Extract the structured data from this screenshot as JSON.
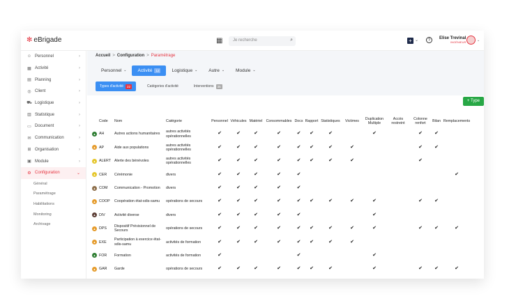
{
  "topbar": {
    "logo": "eBrigade",
    "search_placeholder": "Je recherche",
    "user_name": "Elise Trevinal",
    "user_role": "INGÉNIEUR"
  },
  "sidebar": {
    "items": [
      {
        "label": "Personnel",
        "icon": "person-icon",
        "glyph": "☺"
      },
      {
        "label": "Activité",
        "icon": "calendar-icon",
        "glyph": "▦"
      },
      {
        "label": "Planning",
        "icon": "planning-icon",
        "glyph": "▤"
      },
      {
        "label": "Client",
        "icon": "client-icon",
        "glyph": "◎"
      },
      {
        "label": "Logistique",
        "icon": "logistics-icon",
        "glyph": "⛟"
      },
      {
        "label": "Statistique",
        "icon": "chart-icon",
        "glyph": "▥"
      },
      {
        "label": "Document",
        "icon": "document-icon",
        "glyph": "▭"
      },
      {
        "label": "Communication",
        "icon": "mail-icon",
        "glyph": "✉"
      },
      {
        "label": "Organisation",
        "icon": "org-icon",
        "glyph": "⊞"
      },
      {
        "label": "Module",
        "icon": "module-icon",
        "glyph": "▣"
      },
      {
        "label": "Configuration",
        "icon": "gear-icon",
        "glyph": "⚙"
      }
    ],
    "sub_items": [
      "Général",
      "Paramétrage",
      "Habilitations",
      "Monitoring",
      "Archivage"
    ]
  },
  "breadcrumb": {
    "home": "Accueil",
    "section": "Configuration",
    "current": "Paramétrage",
    "sep": ">"
  },
  "tabs": [
    {
      "label": "Personnel",
      "chevron": "⌄"
    },
    {
      "label": "Activité",
      "count": "12",
      "active": true
    },
    {
      "label": "Logistique",
      "chevron": "⌄"
    },
    {
      "label": "Autre",
      "chevron": "⌄"
    },
    {
      "label": "Module",
      "chevron": "⌄"
    }
  ],
  "subtabs": [
    {
      "label": "Types d'activité",
      "badge": "22",
      "active": true
    },
    {
      "label": "Catégories d'activité"
    },
    {
      "label": "Interventions",
      "badge": "35"
    }
  ],
  "add_button": "+ Type",
  "table": {
    "headers": [
      "",
      "Code",
      "Nom",
      "Catégorie",
      "Personnel",
      "Véhicules",
      "Matériel",
      "Consommables",
      "Docs",
      "Rapport",
      "Statistiques",
      "Victimes",
      "Duplication Multiple",
      "Accès restreint",
      "Colonne renfort",
      "Bilan",
      "Remplacements"
    ],
    "check_glyph": "✔",
    "rows": [
      {
        "color": "#2e7d32",
        "code": "AH",
        "nom": "Autres actions humanitaires",
        "categorie": "autres activités opérationnelles",
        "checks": [
          1,
          1,
          1,
          1,
          1,
          1,
          1,
          0,
          1,
          0,
          1,
          1,
          0
        ]
      },
      {
        "color": "#e59b2b",
        "code": "AP",
        "nom": "Aide aux populations",
        "categorie": "autres activités opérationnelles",
        "checks": [
          1,
          1,
          1,
          1,
          1,
          1,
          1,
          1,
          0,
          0,
          1,
          1,
          0
        ]
      },
      {
        "color": "#e5c62b",
        "code": "ALERT",
        "nom": "Alerte des bénévoles",
        "categorie": "autres activités opérationnelles",
        "checks": [
          1,
          1,
          1,
          1,
          1,
          1,
          1,
          1,
          0,
          0,
          1,
          0,
          0
        ]
      },
      {
        "color": "#e5c62b",
        "code": "CER",
        "nom": "Cérémonie",
        "categorie": "divers",
        "checks": [
          1,
          1,
          1,
          1,
          1,
          0,
          0,
          0,
          0,
          0,
          0,
          0,
          1
        ]
      },
      {
        "color": "#8d6e4a",
        "code": "COM",
        "nom": "Communication - Promotion",
        "categorie": "divers",
        "checks": [
          1,
          1,
          1,
          1,
          1,
          0,
          0,
          0,
          0,
          0,
          0,
          0,
          0
        ]
      },
      {
        "color": "#e59b2b",
        "code": "COOP",
        "nom": "Coopération état-sdis-samu",
        "categorie": "opérations de secours",
        "checks": [
          1,
          1,
          1,
          1,
          1,
          1,
          1,
          1,
          1,
          0,
          1,
          1,
          0
        ]
      },
      {
        "color": "#5d4037",
        "code": "DIV",
        "nom": "Activité diverse",
        "categorie": "divers",
        "checks": [
          1,
          1,
          1,
          1,
          1,
          0,
          0,
          0,
          1,
          0,
          0,
          0,
          0
        ]
      },
      {
        "color": "#e59b2b",
        "code": "DPS",
        "nom": "Dispositif Prévisionnel de Secours",
        "categorie": "opérations de secours",
        "checks": [
          1,
          1,
          1,
          1,
          1,
          1,
          1,
          1,
          1,
          0,
          1,
          1,
          1
        ]
      },
      {
        "color": "#e59b2b",
        "code": "EXE",
        "nom": "Participation à exercice état-sdis-samu",
        "categorie": "activités de formation",
        "checks": [
          1,
          1,
          1,
          1,
          1,
          1,
          1,
          1,
          0,
          0,
          0,
          0,
          0
        ]
      },
      {
        "color": "#2e7d32",
        "code": "FOR",
        "nom": "Formation",
        "categorie": "activités de formation",
        "checks": [
          1,
          0,
          0,
          0,
          1,
          0,
          0,
          0,
          1,
          0,
          0,
          0,
          0
        ]
      },
      {
        "color": "#e59b2b",
        "code": "GAR",
        "nom": "Garde",
        "categorie": "opérations de secours",
        "checks": [
          1,
          1,
          1,
          1,
          1,
          1,
          1,
          0,
          1,
          0,
          1,
          1,
          1
        ]
      }
    ]
  }
}
